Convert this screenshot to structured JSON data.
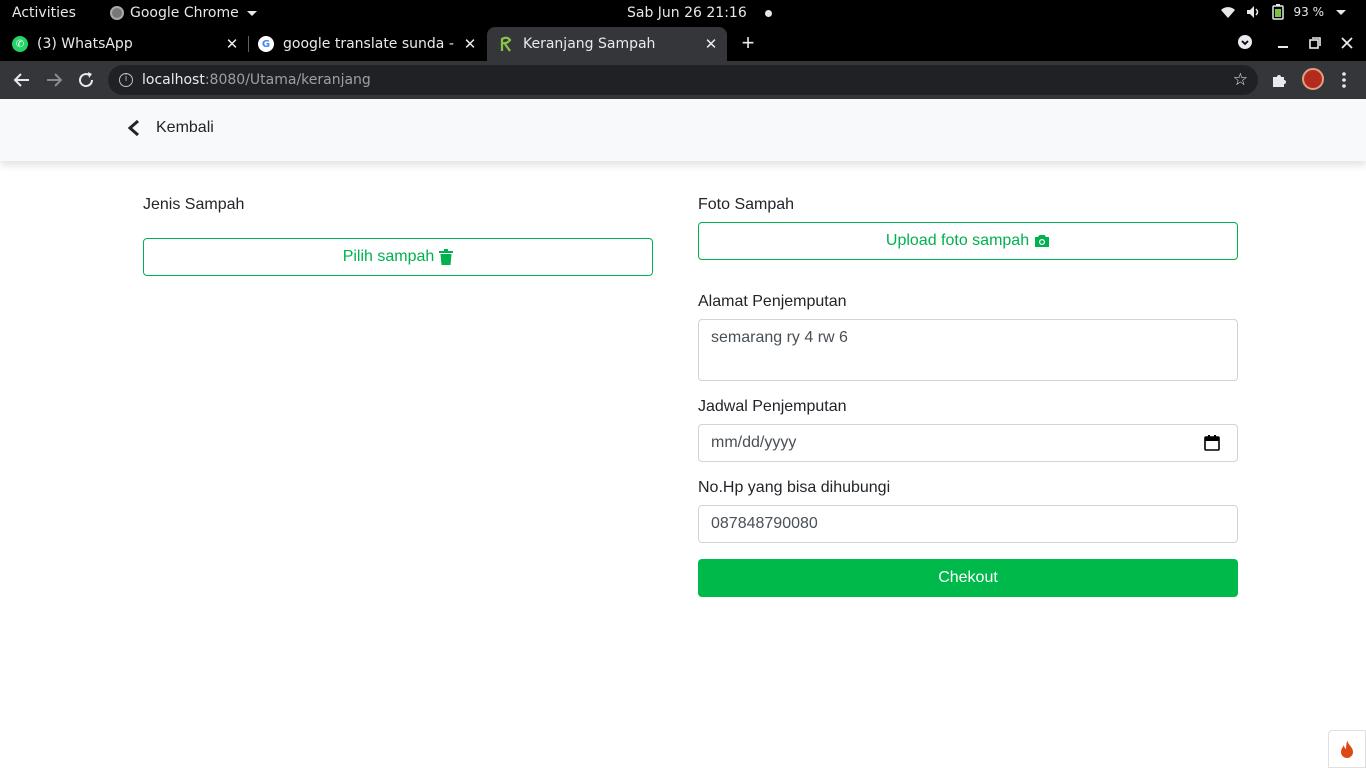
{
  "system_bar": {
    "activities": "Activities",
    "app_name": "Google Chrome",
    "clock": "Sab Jun 26  21:16",
    "battery": "93 %"
  },
  "tabs": [
    {
      "title": "(3) WhatsApp",
      "favicon": "whatsapp-icon",
      "active": false
    },
    {
      "title": "google translate sunda - F",
      "favicon": "google-icon",
      "active": false
    },
    {
      "title": "Keranjang Sampah",
      "favicon": "app-leaf-icon",
      "active": true
    }
  ],
  "omnibox": {
    "host": "localhost",
    "path": ":8080/Utama/keranjang"
  },
  "navbar": {
    "back_label": "Kembali"
  },
  "left": {
    "jenis_label": "Jenis Sampah",
    "pilih_button": "Pilih sampah"
  },
  "right": {
    "foto_label": "Foto Sampah",
    "upload_button": "Upload foto sampah",
    "alamat_label": "Alamat Penjemputan",
    "alamat_value": "semarang ry 4 rw 6",
    "jadwal_label": "Jadwal Penjemputan",
    "jadwal_placeholder": "mm/dd/yyyy",
    "hp_label": "No.Hp yang bisa dihubungi",
    "hp_value": "087848790080",
    "checkout_button": "Chekout"
  },
  "colors": {
    "accent": "#00b14f",
    "solid_button": "#00b94b",
    "chrome_toolbar": "#35363a"
  }
}
